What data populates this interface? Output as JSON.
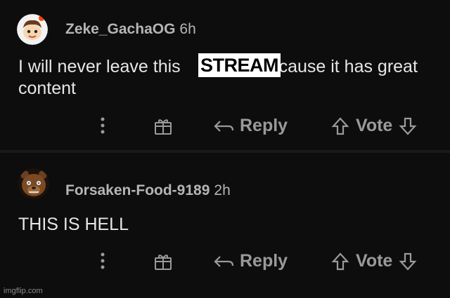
{
  "comments": [
    {
      "username": "Zeke_GachaOG",
      "time": "6h",
      "text_line1_before": "I will never leave this",
      "text_overlay": "STREAM",
      "text_line1_after": "cause it has great",
      "text_line2": "content",
      "avatar_icon": "reddit-snoo-avatar-icon"
    },
    {
      "username": "Forsaken-Food-9189",
      "time": "2h",
      "text": "THIS IS HELL",
      "avatar_icon": "bear-avatar-icon"
    }
  ],
  "actions": {
    "more_icon": "more-vertical-icon",
    "award_icon": "gift-icon",
    "reply_label": "Reply",
    "vote_label": "Vote"
  },
  "watermark": "imgflip.com",
  "colors": {
    "background": "#0b0b0b",
    "text": "#e6e6e6",
    "muted": "#9a9a9a",
    "overlay_bg": "#ffffff"
  }
}
